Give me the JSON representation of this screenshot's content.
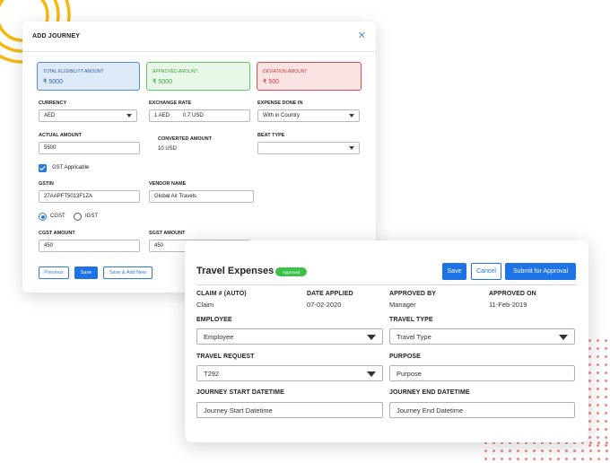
{
  "add_journey": {
    "title": "ADD JOURNEY",
    "close": "✕",
    "summary": {
      "total_label": "TOTAL ELIGIBILITY AMOUNT",
      "total_value": "₹ 5000",
      "approved_label": "APPROVED AMOUNT",
      "approved_value": "₹ 5000",
      "deviation_label": "DEVIATION AMOUNT",
      "deviation_value": "₹ 500"
    },
    "currency": {
      "label": "CURRENCY",
      "value": "AED"
    },
    "exchange_rate": {
      "label": "EXCHANGE RATE",
      "from": "1 AED",
      "to": "0.7 USD"
    },
    "expense_done_in": {
      "label": "EXPENSE DONE IN",
      "value": "With in Country"
    },
    "actual_amount": {
      "label": "ACTUAL AMOUNT",
      "value": "5500"
    },
    "converted_amount": {
      "label": "CONVERTED AMOUNT",
      "value": "10 USD"
    },
    "beat_type": {
      "label": "BEAT TYPE",
      "value": ""
    },
    "gst_applicable": {
      "label": "GST Applicable",
      "checked": true
    },
    "gstin": {
      "label": "GSTIN",
      "value": "27AAPFT5013F1ZA"
    },
    "vendor_name": {
      "label": "VENDOR NAME",
      "value": "Global Air Travels"
    },
    "tax_type": {
      "cgst_label": "CGST",
      "igst_label": "IGST",
      "selected": "CGST"
    },
    "cgst_amount": {
      "label": "CGST AMOUNT",
      "value": "450"
    },
    "sgst_amount": {
      "label": "SGST AMOUNT",
      "value": "450"
    },
    "buttons": {
      "previous": "Previous",
      "save": "Save",
      "save_add_new": "Save & Add New"
    }
  },
  "travel_expenses": {
    "title": "Travel Expenses",
    "status_badge": "Approved",
    "buttons": {
      "save": "Save",
      "cancel": "Cancel",
      "submit": "Submit for Approval"
    },
    "claim": {
      "label": "CLAIM # (AUTO)",
      "value": "Claim"
    },
    "date_applied": {
      "label": "DATE APPLIED",
      "value": "07-02-2020"
    },
    "approved_by": {
      "label": "APPROVED BY",
      "value": "Manager"
    },
    "approved_on": {
      "label": "APPROVED ON",
      "value": "11-Feb-2019"
    },
    "employee": {
      "label": "EMPLOYEE",
      "value": "Employee"
    },
    "travel_type": {
      "label": "TRAVEL TYPE",
      "value": "Travel Type"
    },
    "travel_request": {
      "label": "TRAVEL REQUEST",
      "value": "T292"
    },
    "purpose": {
      "label": "PURPOSE",
      "value": "Purpose"
    },
    "journey_start": {
      "label": "JOURNEY START DATETIME",
      "value": "Journey Start Datetime"
    },
    "journey_end": {
      "label": "JOURNEY END DATETIME",
      "value": "Journey End Datetime"
    }
  },
  "colors": {
    "primary": "#1e73e6",
    "approved_green": "#3fc04a",
    "deviation_red": "#e04b4b",
    "decor_orange": "#f5b80a",
    "decor_dots": "#f08a84"
  }
}
